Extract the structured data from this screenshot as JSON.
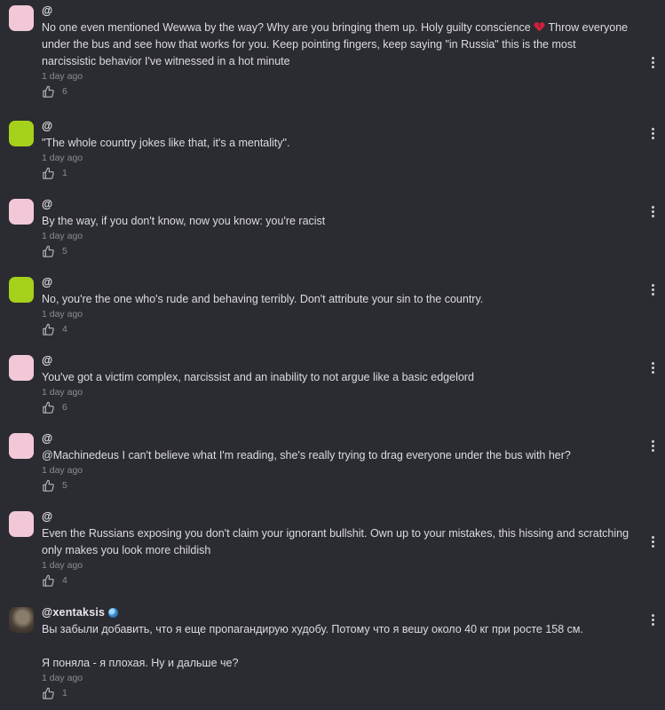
{
  "comments": [
    {
      "avatar_color": "#f2c8d8",
      "author": "@",
      "text_before_heart": "No one even mentioned Wewwa by the way? Why are you bringing them up. Holy guilty conscience ",
      "text_after_heart": " Throw everyone under the bus and see how that works for you. Keep pointing fingers, keep saying \"in Russia\" this is the most narcissistic behavior I've witnessed in a hot minute",
      "time": "1 day ago",
      "likes": "6"
    },
    {
      "avatar_color": "#a6d11b",
      "author": "@",
      "text": "\"The whole country jokes like that, it's a mentality\".",
      "time": "1 day ago",
      "likes": "1"
    },
    {
      "avatar_color": "#f2c8d8",
      "author": "@",
      "text": "By the way, if you don't know, now you know: you're racist",
      "time": "1 day ago",
      "likes": "5"
    },
    {
      "avatar_color": "#a6d11b",
      "author": "@",
      "text": "No, you're the one who's rude and behaving terribly. Don't attribute your sin to the country.",
      "time": "1 day ago",
      "likes": "4"
    },
    {
      "avatar_color": "#f2c8d8",
      "author": "@",
      "text": "You've got a victim complex, narcissist and an inability to not argue like a basic edgelord",
      "time": "1 day ago",
      "likes": "6"
    },
    {
      "avatar_color": "#f2c8d8",
      "author": "@",
      "text": "@Machinedeus I can't believe what I'm reading, she's really trying to drag everyone under the bus with her?",
      "time": "1 day ago",
      "likes": "5"
    },
    {
      "avatar_color": "#f2c8d8",
      "author": "@",
      "text": "Even the Russians exposing you don't claim your ignorant bullshit. Own up to your mistakes, this hissing and scratching only makes you look more childish",
      "time": "1 day ago",
      "likes": "4"
    },
    {
      "avatar_color": "photo",
      "author": "@xentaksis",
      "text": "Вы забыли добавить, что я еще пропагандирую худобу. Потому что я вешу около 40 кг при росте 158 см.\n\nЯ поняла - я плохая. Ну и дальше че?",
      "time": "1 day ago",
      "likes": "1"
    }
  ],
  "icons": {
    "like": "thumbs-up-icon",
    "more": "more-vertical-icon",
    "heart": "broken-heart-emoji",
    "verified": "globe-icon"
  },
  "colors": {
    "background": "#2b2c31",
    "text": "#dcdce0",
    "muted": "#8b8c93",
    "heart": "#d01f3c"
  }
}
